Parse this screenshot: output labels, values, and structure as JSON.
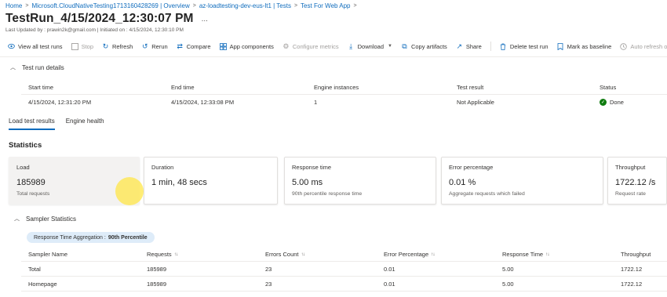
{
  "breadcrumb": {
    "items": [
      "Home",
      "Microsoft.CloudNativeTesting1713160428269 | Overview",
      "az-loadtesting-dev-eus-lt1 | Tests",
      "Test For Web App"
    ],
    "separator": ">"
  },
  "header": {
    "title": "TestRun_4/15/2024_12:30:07 PM",
    "more": "...",
    "subtitle": "Last Updated by : prawin2k@gmail.com | Initiated on : 4/15/2024, 12:30:10 PM"
  },
  "toolbar": {
    "view_all": "View all test runs",
    "stop": "Stop",
    "refresh": "Refresh",
    "rerun": "Rerun",
    "compare": "Compare",
    "app_components": "App components",
    "configure_metrics": "Configure metrics",
    "download": "Download",
    "copy_artifacts": "Copy artifacts",
    "share": "Share",
    "delete": "Delete test run",
    "mark_baseline": "Mark as baseline",
    "auto_refresh": "Auto refresh off"
  },
  "details": {
    "section_title": "Test run details",
    "headers": [
      "Start time",
      "End time",
      "Engine instances",
      "Test result",
      "Status"
    ],
    "row": {
      "start": "4/15/2024, 12:31:20 PM",
      "end": "4/15/2024, 12:33:08 PM",
      "engines": "1",
      "result": "Not Applicable",
      "status": "Done"
    }
  },
  "tabs": [
    "Load test results",
    "Engine health"
  ],
  "statistics": {
    "title": "Statistics",
    "cards": [
      {
        "label": "Load",
        "value": "185989",
        "foot": "Total requests"
      },
      {
        "label": "Duration",
        "value": "1 min, 48 secs",
        "foot": ""
      },
      {
        "label": "Response time",
        "value": "5.00 ms",
        "foot": "90th percentile response time"
      },
      {
        "label": "Error percentage",
        "value": "0.01 %",
        "foot": "Aggregate requests which failed"
      },
      {
        "label": "Throughput",
        "value": "1722.12 /s",
        "foot": "Request rate"
      }
    ]
  },
  "sampler": {
    "section_title": "Sampler Statistics",
    "aggregation_label": "Response Time Aggregation :",
    "aggregation_value": "90th Percentile",
    "headers": [
      "Sampler Name",
      "Requests",
      "Errors Count",
      "Error Percentage",
      "Response Time",
      "Throughput"
    ],
    "rows": [
      [
        "Total",
        "185989",
        "23",
        "0.01",
        "5.00",
        "1722.12"
      ],
      [
        "Homepage",
        "185989",
        "23",
        "0.01",
        "5.00",
        "1722.12"
      ]
    ]
  },
  "colors": {
    "accent": "#0f6cbd",
    "success": "#107c10",
    "pill_bg": "#deecf9",
    "cursor_highlight": "#ffe63c"
  }
}
